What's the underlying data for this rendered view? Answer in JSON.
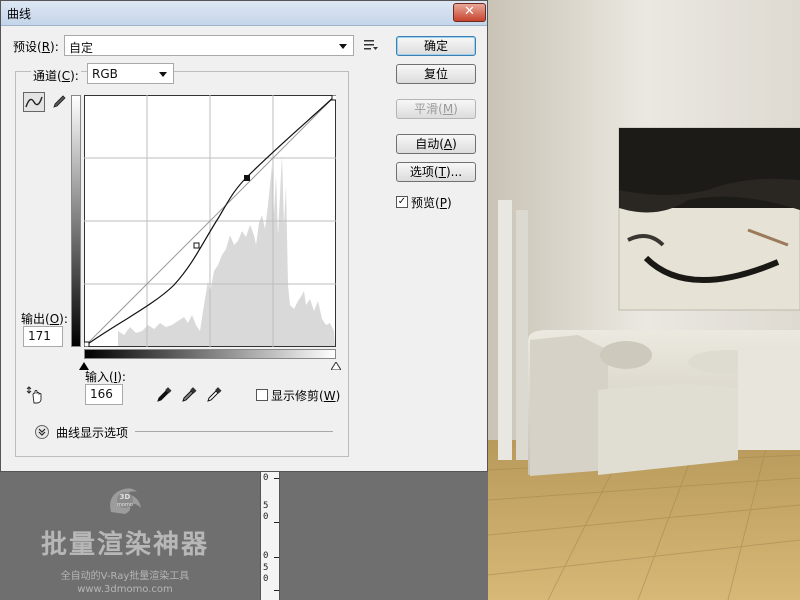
{
  "dialog": {
    "title": "曲线",
    "close_glyph": "✕",
    "preset": {
      "label_pre": "预设(",
      "label_key": "R",
      "label_post": "):",
      "value": "自定"
    },
    "channel": {
      "label_pre": "通道(",
      "label_key": "C",
      "label_post": "):",
      "value": "RGB"
    },
    "output": {
      "label_pre": "输出(",
      "label_key": "O",
      "label_post": "):",
      "value": "171"
    },
    "input": {
      "label_pre": "输入(",
      "label_key": "I",
      "label_post": "):",
      "value": "166"
    },
    "show_clipping": {
      "label_pre": "显示修剪(",
      "label_key": "W",
      "label_post": ")",
      "checked": false
    },
    "curve_options": {
      "label": "曲线显示选项",
      "expander_glyph": "⌄"
    },
    "buttons": {
      "ok": "确定",
      "reset": "复位",
      "smooth_pre": "平滑(",
      "smooth_key": "M",
      "smooth_post": ")",
      "auto_pre": "自动(",
      "auto_key": "A",
      "auto_post": ")",
      "options_pre": "选项(",
      "options_key": "T",
      "options_post": ")..."
    },
    "preview": {
      "label_pre": "预览(",
      "label_key": "P",
      "label_post": ")",
      "checked": true,
      "check_glyph": "✓"
    }
  },
  "ruler": {
    "labels": [
      "0",
      "5",
      "0",
      "0",
      "5",
      "0"
    ]
  },
  "watermark": {
    "logo_text": "3D\nmomo",
    "title": "批量渲染神器",
    "subtitle": "全自动的V-Ray批量渲染工具",
    "url": "www.3dmomo.com"
  },
  "colors": {
    "title_bar": "#c4d5ea",
    "close_button": "#c7442e",
    "default_button_border": "#3c7fb1"
  },
  "icons": [
    "curve-tool-icon",
    "pencil-icon",
    "preset-menu-icon",
    "on-image-adjust-icon",
    "black-eyedropper-icon",
    "gray-eyedropper-icon",
    "white-eyedropper-icon",
    "expand-icon",
    "close-icon"
  ]
}
